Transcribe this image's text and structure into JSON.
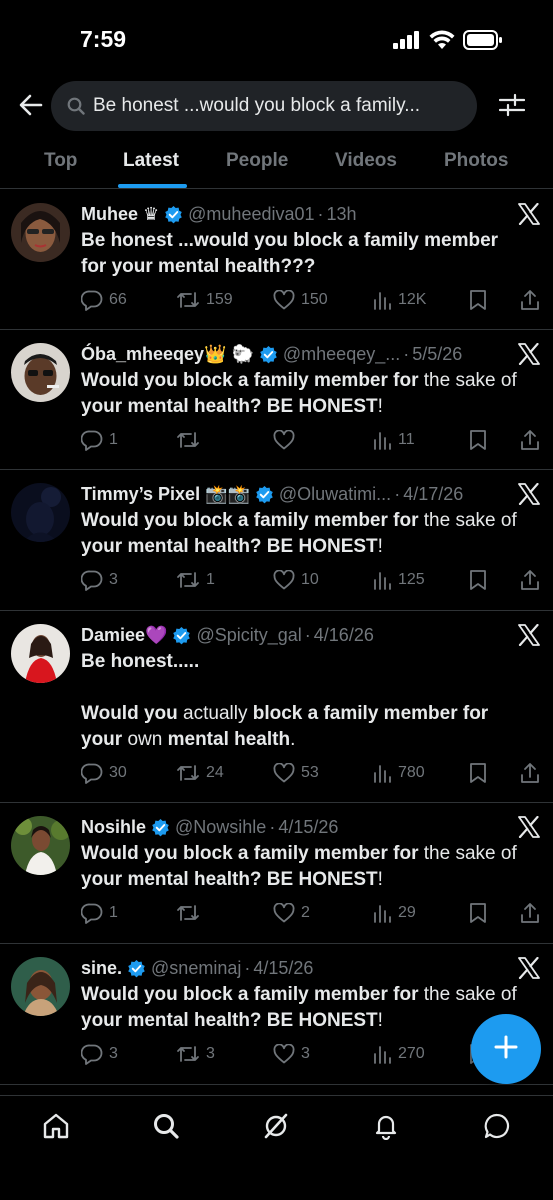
{
  "status_bar": {
    "time": "7:59"
  },
  "search": {
    "query": "Be honest ...would you block a family..."
  },
  "tabs": [
    {
      "label": "Top",
      "active": false
    },
    {
      "label": "Latest",
      "active": true
    },
    {
      "label": "People",
      "active": false
    },
    {
      "label": "Videos",
      "active": false
    },
    {
      "label": "Photos",
      "active": false
    }
  ],
  "colors": {
    "accent": "#1d9bf0",
    "background": "#000000",
    "muted": "#71767b",
    "text": "#e7e9ea",
    "divider": "#2f3336"
  },
  "tweets": [
    {
      "name": "Muhee ♛",
      "handle": "@muheediva01",
      "time": "13h",
      "body_lines": [
        "Be honest ...would you block a family member",
        "for your mental health???"
      ],
      "replies": "66",
      "reposts": "159",
      "likes": "150",
      "views": "12K"
    },
    {
      "name": "Óba_mheeqey👑 🐑",
      "handle": "@mheeqey_...",
      "time": "5/5/26",
      "body_bold_1": "Would you block a family member for",
      "body_plain_1": " the sake of",
      "body_bold_2": "your mental health? BE HONEST",
      "body_plain_2": "!",
      "replies": "1",
      "reposts": "",
      "likes": "",
      "views": "11"
    },
    {
      "name": "Timmy’s Pixel 📸📸",
      "handle": "@Oluwatimi...",
      "time": "4/17/26",
      "body_bold_1": "Would you block a family member for",
      "body_plain_1": " the sake of",
      "body_bold_2": "your mental health? BE HONEST",
      "body_plain_2": "!",
      "replies": "3",
      "reposts": "1",
      "likes": "10",
      "views": "125"
    },
    {
      "name": "Damiee💜",
      "handle": "@Spicity_gal",
      "time": "4/16/26",
      "line1": "Be honest.....",
      "l3a": "Would you",
      "l3b": " actually ",
      "l3c": "block a family member for",
      "l4a": "your",
      "l4b": " own ",
      "l4c": "mental health",
      "l4d": ".",
      "replies": "30",
      "reposts": "24",
      "likes": "53",
      "views": "780"
    },
    {
      "name": "Nosihle",
      "handle": "@Nowsihle",
      "time": "4/15/26",
      "body_bold_1": "Would you block a family member for",
      "body_plain_1": " the sake of",
      "body_bold_2": "your mental health? BE HONEST",
      "body_plain_2": "!",
      "replies": "1",
      "reposts": "",
      "likes": "2",
      "views": "29"
    },
    {
      "name": "sine.",
      "handle": "@sneminaj",
      "time": "4/15/26",
      "body_bold_1": "Would you block a family member for",
      "body_plain_1": " the sake of",
      "body_bold_2": "your mental health? BE HONEST",
      "body_plain_2": "!",
      "replies": "3",
      "reposts": "3",
      "likes": "3",
      "views": "270"
    }
  ],
  "icons": {
    "status": [
      "signal-icon",
      "wifi-icon",
      "battery-icon"
    ],
    "header": [
      "back-arrow-icon",
      "search-icon",
      "filter-icon"
    ],
    "bottom_nav": [
      "home-icon",
      "search-icon",
      "grok-icon",
      "bell-icon",
      "messages-icon"
    ]
  }
}
